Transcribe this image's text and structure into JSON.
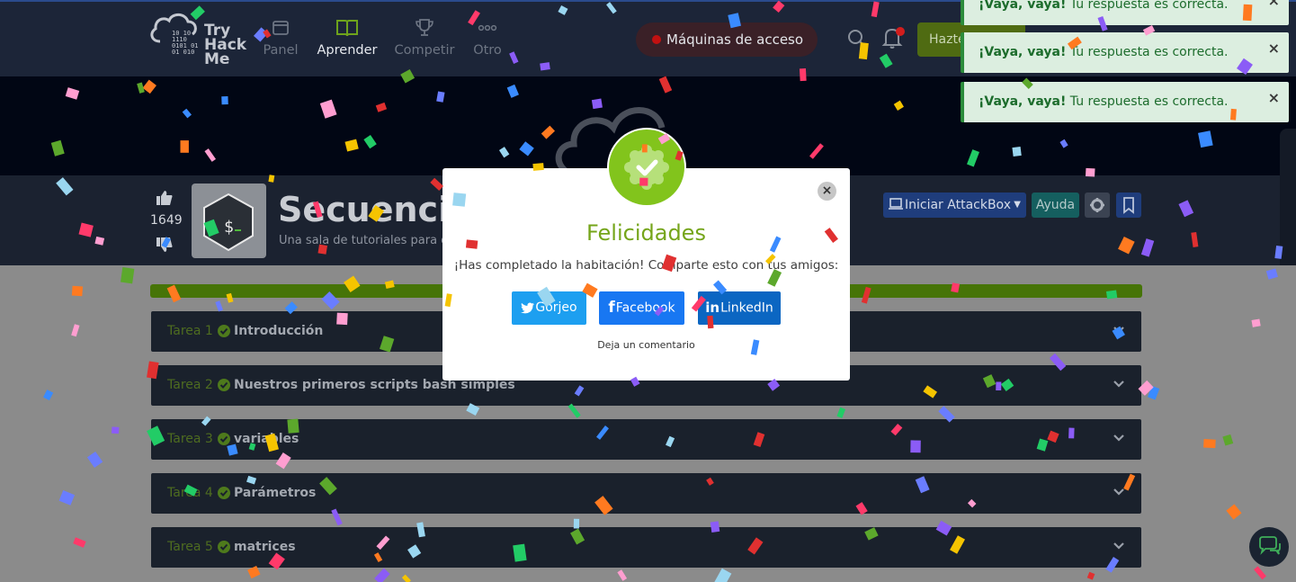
{
  "nav": {
    "logo_word_1": "Try",
    "logo_word_2": "Hack",
    "logo_word_3": "Me",
    "logo_binary": [
      "10  10",
      "1110",
      "0101 01",
      "01  010"
    ],
    "items": [
      {
        "label": "Panel",
        "icon": "dashboard-icon"
      },
      {
        "label": "Aprender",
        "icon": "book-icon"
      },
      {
        "label": "Competir",
        "icon": "trophy-icon"
      },
      {
        "label": "Otro",
        "icon": "dots-icon"
      }
    ],
    "machines_label": "Máquinas de acceso",
    "subscribe_label": "Hazte"
  },
  "room": {
    "likes": "1649",
    "title": "Secuencias",
    "subtitle": "Una sala de tutoriales para e",
    "attackbox_label": "Iniciar AttackBox",
    "help_label": "Ayuda"
  },
  "tasks": [
    {
      "num": "Tarea 1",
      "name": "Introducción"
    },
    {
      "num": "Tarea 2",
      "name": "Nuestros primeros scripts bash simples"
    },
    {
      "num": "Tarea 3",
      "name": "variables"
    },
    {
      "num": "Tarea 4",
      "name": "Parámetros"
    },
    {
      "num": "Tarea 5",
      "name": "matrices"
    }
  ],
  "modal": {
    "title": "Felicidades",
    "subtitle": "¡Has completado la habitación! Comparte esto con tus amigos:",
    "share_twitter": "Gorjeo",
    "share_facebook": "Facebook",
    "share_linkedin": "LinkedIn",
    "comment_link": "Deja un comentario"
  },
  "toasts": [
    {
      "bold": "¡Vaya, vaya!",
      "text": " Tu respuesta es correcta."
    },
    {
      "bold": "¡Vaya, vaya!",
      "text": " Tu respuesta es correcta."
    },
    {
      "bold": "¡Vaya, vaya!",
      "text": " Tu respuesta es correcta."
    }
  ],
  "colors": {
    "brand_green": "#82c41c",
    "title_green": "#75a51a",
    "toast_green": "#2c8c3c"
  },
  "confetti_colors": [
    "#f5c400",
    "#5ca82c",
    "#ff3a6a",
    "#3a8bff",
    "#ff7a20",
    "#8b5cf6",
    "#9ad6f0",
    "#ff9ed0",
    "#22cc66",
    "#e03030",
    "#6a7dff"
  ]
}
